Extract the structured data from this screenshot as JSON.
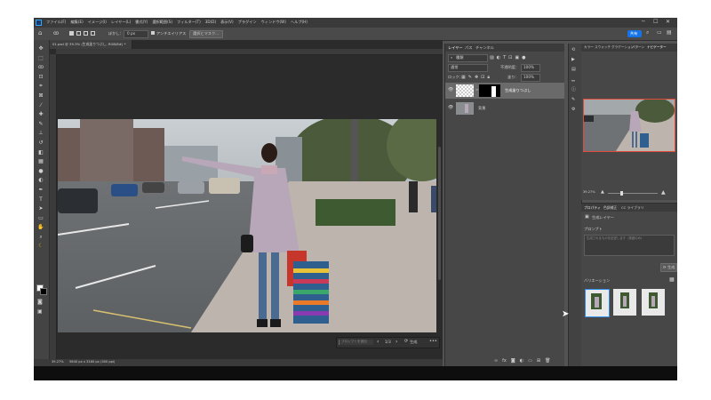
{
  "app": {
    "logo_icon": "ps-logo-icon"
  },
  "menubar": {
    "items": [
      "ファイル(F)",
      "編集(E)",
      "イメージ(I)",
      "レイヤー(L)",
      "書式(Y)",
      "選択範囲(S)",
      "フィルター(T)",
      "3D(D)",
      "表示(V)",
      "プラグイン",
      "ウィンドウ(W)",
      "ヘルプ(H)"
    ]
  },
  "optionsbar": {
    "feather_label": "ぼかし：",
    "feather_value": "0 px",
    "antialias_label": "アンチエイリアス",
    "select_mask_label": "選択とマスク...",
    "share_label": "共有"
  },
  "document": {
    "tab_title": "01.psd @ 39.3% (生成塗りつぶし, RGB/8#) *",
    "zoom_status": "39.27%",
    "size_status": "5640 px x 3160 px (300 ppi)"
  },
  "contextbar": {
    "placeholder": "プロンプトを追加",
    "counter": "1/3",
    "generate_label": "生成"
  },
  "layers_panel": {
    "tabs": [
      "レイヤー",
      "パス",
      "チャンネル"
    ],
    "filter_label": "種類",
    "blend_mode": "通常",
    "opacity_label": "不透明度：",
    "opacity_value": "100%",
    "lock_label": "ロック：",
    "fill_label": "塗り：",
    "fill_value": "100%",
    "layers": [
      {
        "name": "生成塗りつぶし",
        "selected": true
      },
      {
        "name": "背景",
        "selected": false
      }
    ]
  },
  "navigator_panel": {
    "tabs": [
      "カラー",
      "スウォッチ",
      "グラデーション",
      "パターン",
      "ナビゲーター"
    ],
    "zoom": "39.27%"
  },
  "properties_panel": {
    "tabs": [
      "プロパティ",
      "色調補正",
      "CC ライブラリ"
    ],
    "header": "生成レイヤー",
    "prompt_label": "プロンプト",
    "prompt_placeholder": "生成されるものを記述します（英語のみ）",
    "generate_button": "生成",
    "variations_label": "バリエーション"
  }
}
